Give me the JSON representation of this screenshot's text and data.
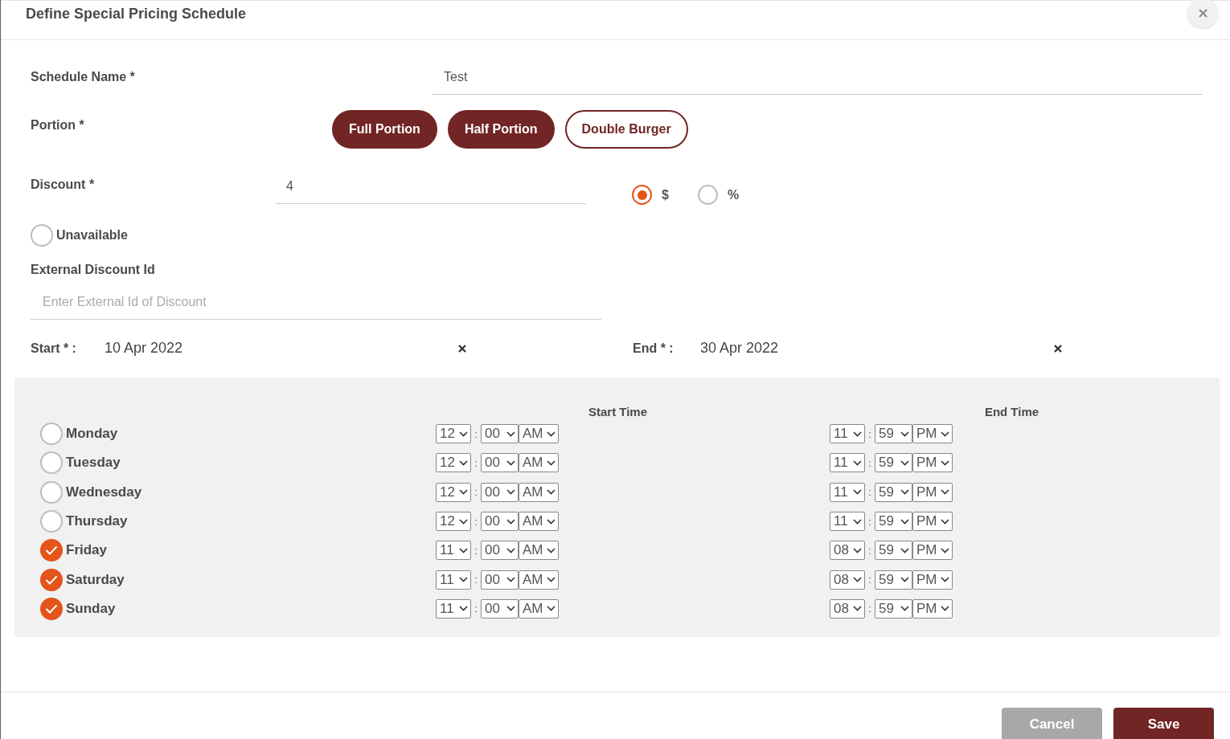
{
  "dialog": {
    "title": "Define Special Pricing Schedule"
  },
  "schedule_name": {
    "label": "Schedule Name *",
    "value": "Test"
  },
  "portion": {
    "label": "Portion *",
    "options": [
      {
        "label": "Full Portion",
        "selected": true
      },
      {
        "label": "Half Portion",
        "selected": true
      },
      {
        "label": "Double Burger",
        "selected": false
      }
    ]
  },
  "discount": {
    "label": "Discount *",
    "value": "4",
    "units": [
      {
        "label": "$",
        "selected": true
      },
      {
        "label": "%",
        "selected": false
      }
    ]
  },
  "unavailable": {
    "label": "Unavailable",
    "checked": false
  },
  "external_discount_id": {
    "label": "External Discount Id",
    "placeholder": "Enter External Id of Discount"
  },
  "start": {
    "label": "Start * :",
    "value": "10 Apr 2022"
  },
  "end": {
    "label": "End * :",
    "value": "30 Apr 2022"
  },
  "schedule": {
    "start_time_heading": "Start Time",
    "end_time_heading": "End Time",
    "time_separator": ":",
    "days": [
      {
        "day": "Monday",
        "checked": false,
        "start": {
          "hour": "12",
          "minute": "00",
          "period": "AM"
        },
        "end": {
          "hour": "11",
          "minute": "59",
          "period": "PM"
        }
      },
      {
        "day": "Tuesday",
        "checked": false,
        "start": {
          "hour": "12",
          "minute": "00",
          "period": "AM"
        },
        "end": {
          "hour": "11",
          "minute": "59",
          "period": "PM"
        }
      },
      {
        "day": "Wednesday",
        "checked": false,
        "start": {
          "hour": "12",
          "minute": "00",
          "period": "AM"
        },
        "end": {
          "hour": "11",
          "minute": "59",
          "period": "PM"
        }
      },
      {
        "day": "Thursday",
        "checked": false,
        "start": {
          "hour": "12",
          "minute": "00",
          "period": "AM"
        },
        "end": {
          "hour": "11",
          "minute": "59",
          "period": "PM"
        }
      },
      {
        "day": "Friday",
        "checked": true,
        "start": {
          "hour": "11",
          "minute": "00",
          "period": "AM"
        },
        "end": {
          "hour": "08",
          "minute": "59",
          "period": "PM"
        }
      },
      {
        "day": "Saturday",
        "checked": true,
        "start": {
          "hour": "11",
          "minute": "00",
          "period": "AM"
        },
        "end": {
          "hour": "08",
          "minute": "59",
          "period": "PM"
        }
      },
      {
        "day": "Sunday",
        "checked": true,
        "start": {
          "hour": "11",
          "minute": "00",
          "period": "AM"
        },
        "end": {
          "hour": "08",
          "minute": "59",
          "period": "PM"
        }
      }
    ]
  },
  "buttons": [
    {
      "label": "Cancel",
      "disabled": true
    },
    {
      "label": "Save",
      "disabled": false
    }
  ]
}
